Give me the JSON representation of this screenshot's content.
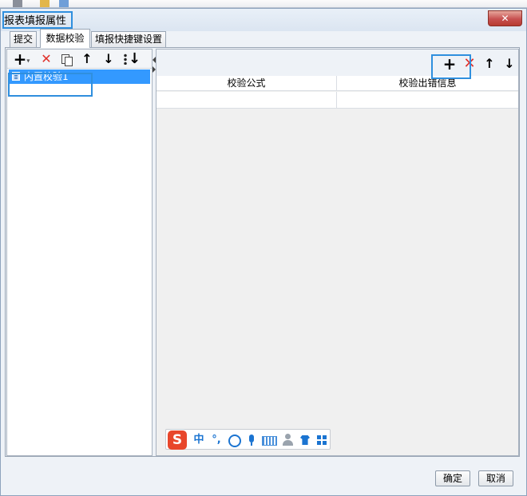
{
  "window": {
    "title": "报表填报属性",
    "close_glyph": "✕"
  },
  "tabs": [
    {
      "label": "提交"
    },
    {
      "label": "数据校验",
      "selected": true
    },
    {
      "label": "填报快捷键设置"
    }
  ],
  "left_toolbar": {
    "icons": [
      "add-dropdown-icon",
      "delete-icon",
      "copy-icon",
      "move-up-icon",
      "move-down-icon",
      "move-bottom-icon"
    ],
    "add_glyph": "+",
    "dropdown_glyph": "▾",
    "delete_glyph": "✕",
    "up_glyph": "↑",
    "down_glyph": "↓"
  },
  "tree": {
    "items": [
      {
        "label": "内置校验1",
        "selected": true
      }
    ]
  },
  "right_toolbar": {
    "icons": [
      "add-icon",
      "delete-icon",
      "move-up-icon",
      "move-down-icon"
    ],
    "add_glyph": "+",
    "delete_glyph": "✕",
    "up_glyph": "↑",
    "down_glyph": "↓"
  },
  "grid": {
    "columns": [
      "校验公式",
      "校验出错信息"
    ],
    "rows": [
      [
        "",
        ""
      ]
    ]
  },
  "ime_toolbar": {
    "logo": "S",
    "mode": "中",
    "punct": "°,",
    "icons": [
      "sogou-logo-icon",
      "chinese-mode-icon",
      "punctuation-icon",
      "emoji-icon",
      "microphone-icon",
      "keyboard-icon",
      "user-icon",
      "skin-icon",
      "grid-menu-icon"
    ]
  },
  "buttons": {
    "ok": "确定",
    "cancel": "取消"
  },
  "colors": {
    "accent": "#3399ff",
    "highlight_box": "#2f8fde",
    "delete_red": "#e0302a",
    "close_red": "#c75050"
  }
}
